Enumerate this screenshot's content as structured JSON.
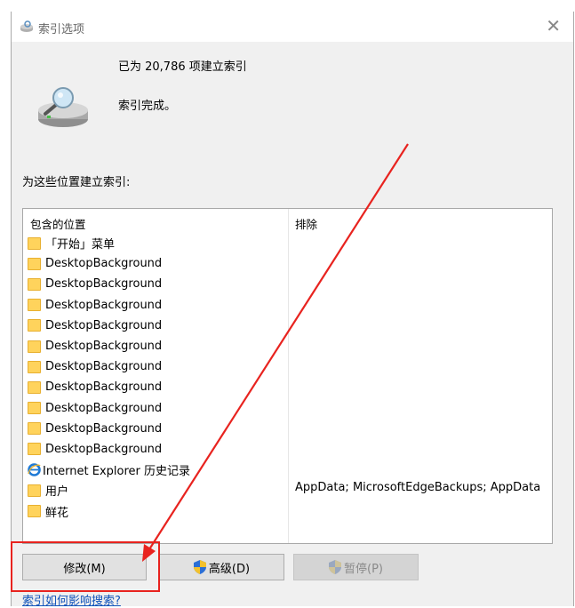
{
  "window": {
    "title": "索引选项",
    "close_glyph": "✕"
  },
  "status": {
    "count_text": "已为 20,786 项建立索引",
    "state_text": "索引完成。"
  },
  "section_label": "为这些位置建立索引:",
  "list": {
    "headers": {
      "included": "包含的位置",
      "excluded": "排除"
    },
    "items": [
      {
        "label": "「开始」菜单",
        "icon": "folder-icon"
      },
      {
        "label": "DesktopBackground",
        "icon": "folder-icon"
      },
      {
        "label": "DesktopBackground",
        "icon": "folder-icon"
      },
      {
        "label": "DesktopBackground",
        "icon": "folder-icon"
      },
      {
        "label": "DesktopBackground",
        "icon": "folder-icon"
      },
      {
        "label": "DesktopBackground",
        "icon": "folder-icon"
      },
      {
        "label": "DesktopBackground",
        "icon": "folder-icon"
      },
      {
        "label": "DesktopBackground",
        "icon": "folder-icon"
      },
      {
        "label": "DesktopBackground",
        "icon": "folder-icon"
      },
      {
        "label": "DesktopBackground",
        "icon": "folder-icon"
      },
      {
        "label": "DesktopBackground",
        "icon": "folder-icon"
      },
      {
        "label": "Internet Explorer 历史记录",
        "icon": "ie-icon"
      },
      {
        "label": "用户",
        "icon": "folder-icon"
      },
      {
        "label": "鲜花",
        "icon": "folder-icon"
      }
    ],
    "user_exclusions": "AppData; MicrosoftEdgeBackups; AppData"
  },
  "buttons": {
    "modify": "修改(M)",
    "advanced": "高级(D)",
    "pause": "暂停(P)"
  },
  "help_link": "索引如何影响搜索?",
  "colors": {
    "annotation": "#e8231f",
    "link": "#0f52ba",
    "folder": "#ffd35c"
  }
}
